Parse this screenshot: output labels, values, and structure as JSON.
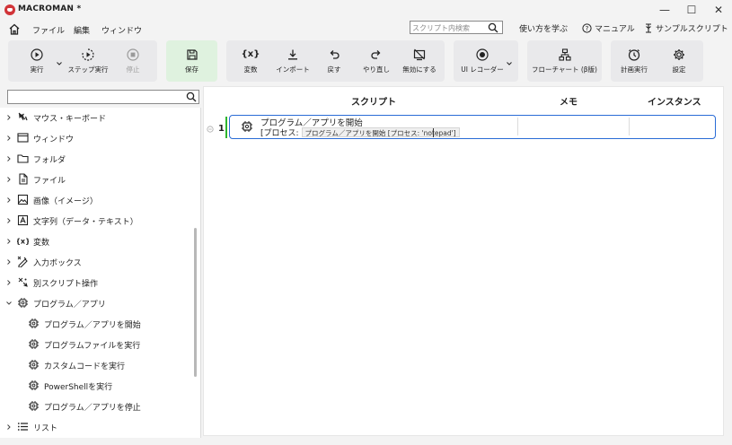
{
  "app": {
    "title": "MACROMAN *",
    "window_controls": {
      "minimize": "—",
      "maximize": "☐",
      "close": "✕"
    }
  },
  "menu": {
    "items": [
      "ファイル",
      "編集",
      "ウィンドウ"
    ],
    "search_placeholder": "スクリプト内検索",
    "links": [
      "使い方を学ぶ",
      "マニュアル",
      "サンプルスクリプト"
    ]
  },
  "toolbar": {
    "run": "実行",
    "step_run": "ステップ実行",
    "stop": "停止",
    "save": "保存",
    "variable": "変数",
    "import": "インポート",
    "undo": "戻す",
    "redo": "やり直し",
    "disable": "無効にする",
    "ui_recorder": "UI レコーダー",
    "flowchart": "フローチャート (β版)",
    "schedule": "計画実行",
    "settings": "設定",
    "variable_glyph": "{x}"
  },
  "left_panel": {
    "search_value": "",
    "tree": [
      {
        "label": "マウス・キーボード",
        "icon": "mouse-icon",
        "expanded": false
      },
      {
        "label": "ウィンドウ",
        "icon": "window-icon",
        "expanded": false
      },
      {
        "label": "フォルダ",
        "icon": "folder-icon",
        "expanded": false
      },
      {
        "label": "ファイル",
        "icon": "file-icon",
        "expanded": false
      },
      {
        "label": "画像（イメージ）",
        "icon": "image-icon",
        "expanded": false
      },
      {
        "label": "文字列（データ・テキスト）",
        "icon": "text-icon",
        "expanded": false
      },
      {
        "label": "変数",
        "icon": "variable-icon",
        "expanded": false
      },
      {
        "label": "入力ボックス",
        "icon": "input-box-icon",
        "expanded": false
      },
      {
        "label": "別スクリプト操作",
        "icon": "script-icon",
        "expanded": false
      },
      {
        "label": "プログラム／アプリ",
        "icon": "chip-icon",
        "expanded": true
      },
      {
        "label": "プログラム／アプリを開始",
        "icon": "chip-icon",
        "child": true
      },
      {
        "label": "プログラムファイルを実行",
        "icon": "chip-icon",
        "child": true
      },
      {
        "label": "カスタムコードを実行",
        "icon": "chip-icon",
        "child": true
      },
      {
        "label": "PowerShellを実行",
        "icon": "chip-icon",
        "child": true
      },
      {
        "label": "プログラム／アプリを停止",
        "icon": "chip-icon",
        "child": true
      },
      {
        "label": "リスト",
        "icon": "list-icon",
        "expanded": false
      }
    ]
  },
  "script_panel": {
    "headers": {
      "script": "スクリプト",
      "memo": "メモ",
      "instance": "インスタンス"
    },
    "rows": [
      {
        "number": "1",
        "title": "プログラム／アプリを開始",
        "sub_label": "[プロセス:",
        "sub_value": "プログラム／アプリを開始 [プロセス: 'notepad']"
      }
    ]
  }
}
